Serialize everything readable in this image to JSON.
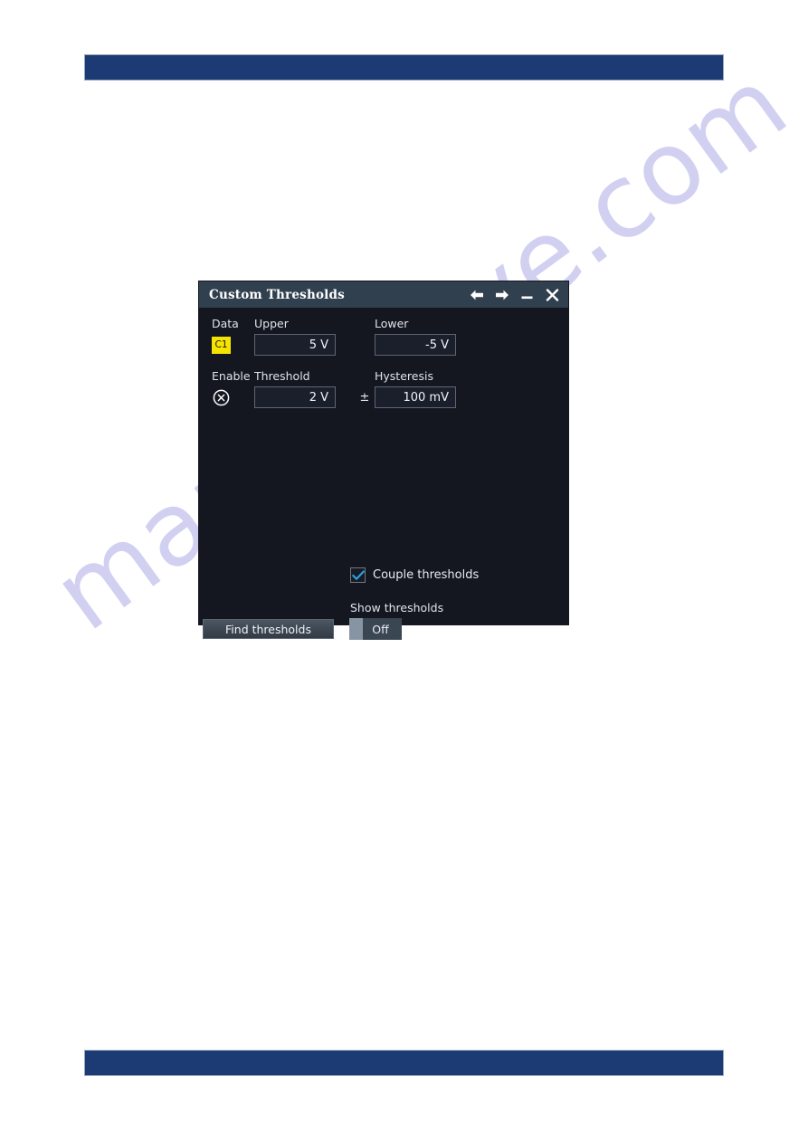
{
  "page": {
    "watermark_text": "manualslive.com",
    "header_bar_color": "#1c3a73",
    "footer_bar_color": "#1c3a73",
    "background_color": "#ffffff"
  },
  "dialog": {
    "title": "Custom Thresholds",
    "background_color": "#141720",
    "titlebar_color": "#31404f",
    "titlebar_icons": [
      {
        "name": "back-arrow-icon",
        "glyph": "←"
      },
      {
        "name": "forward-arrow-icon",
        "glyph": "→"
      },
      {
        "name": "minimize-icon",
        "glyph": "–"
      },
      {
        "name": "close-icon",
        "glyph": "✕"
      }
    ],
    "row1": {
      "data_label": "Data",
      "upper_label": "Upper",
      "lower_label": "Lower",
      "channel_badge": "C1",
      "channel_badge_color": "#f5e400",
      "upper_value": "5 V",
      "lower_value": "-5 V"
    },
    "row2": {
      "enable_label": "Enable",
      "threshold_label": "Threshold",
      "hysteresis_label": "Hysteresis",
      "enable_state": "off",
      "enable_icon": "circle-x-icon",
      "threshold_value": "2 V",
      "plus_minus": "±",
      "hysteresis_value": "100 mV"
    },
    "couple": {
      "label": "Couple thresholds",
      "checked": true,
      "check_color": "#2e9fe0"
    },
    "show_thresholds": {
      "label": "Show thresholds",
      "toggle_value": "Off"
    },
    "find_button": {
      "label": "Find thresholds"
    }
  }
}
